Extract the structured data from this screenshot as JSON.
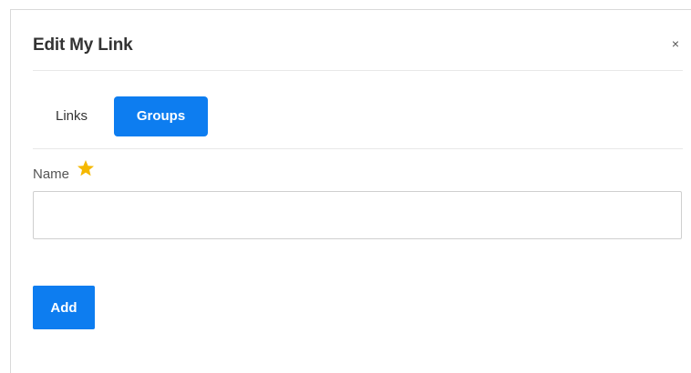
{
  "modal": {
    "title": "Edit My Link",
    "close_label": "×"
  },
  "tabs": [
    {
      "label": "Links",
      "active": false
    },
    {
      "label": "Groups",
      "active": true
    }
  ],
  "form": {
    "name_label": "Name",
    "name_value": "",
    "name_placeholder": "",
    "required_icon": "star-icon",
    "add_label": "Add"
  },
  "colors": {
    "accent": "#0d7df0",
    "required": "#f5b800"
  }
}
